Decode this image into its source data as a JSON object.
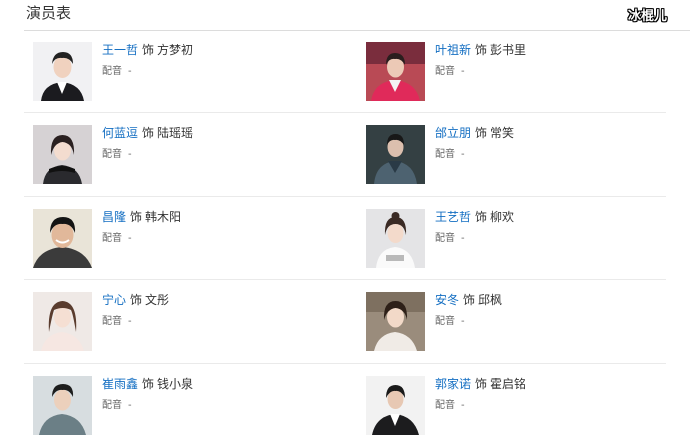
{
  "section": {
    "title": "演员表"
  },
  "watermark": "冰棍儿",
  "labels": {
    "as": "饰",
    "voice": "配音"
  },
  "cast": [
    {
      "actor": "王一哲",
      "role": "方梦初",
      "voice": "-"
    },
    {
      "actor": "叶祖新",
      "role": "彭书里",
      "voice": "-"
    },
    {
      "actor": "何蓝逗",
      "role": "陆瑶瑶",
      "voice": "-"
    },
    {
      "actor": "邰立朋",
      "role": "常笑",
      "voice": "-"
    },
    {
      "actor": "昌隆",
      "role": "韩木阳",
      "voice": "-"
    },
    {
      "actor": "王艺哲",
      "role": "柳欢",
      "voice": "-"
    },
    {
      "actor": "宁心",
      "role": "文彤",
      "voice": "-"
    },
    {
      "actor": "安冬",
      "role": "邱枫",
      "voice": "-"
    },
    {
      "actor": "崔雨鑫",
      "role": "钱小泉",
      "voice": "-"
    },
    {
      "actor": "郭家诺",
      "role": "霍启铭",
      "voice": "-"
    }
  ]
}
